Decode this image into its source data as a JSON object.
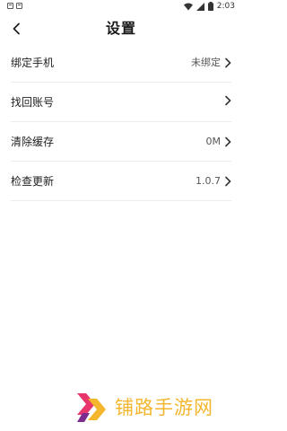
{
  "status_bar": {
    "time": "2:03",
    "icons": [
      "notification-square-icon",
      "notification-square-icon",
      "wifi-icon",
      "signal-icon",
      "battery-icon"
    ]
  },
  "header": {
    "title": "设置",
    "back_icon": "chevron-left-icon"
  },
  "settings": {
    "items": [
      {
        "label": "绑定手机",
        "value": "未绑定"
      },
      {
        "label": "找回账号",
        "value": ""
      },
      {
        "label": "清除缓存",
        "value": "0M"
      },
      {
        "label": "检查更新",
        "value": "1.0.7"
      }
    ]
  },
  "watermark": {
    "text": "铺路手游网",
    "color": "#f3b62d",
    "accent_pink": "#e8356b",
    "accent_purple": "#7b2c8e"
  }
}
